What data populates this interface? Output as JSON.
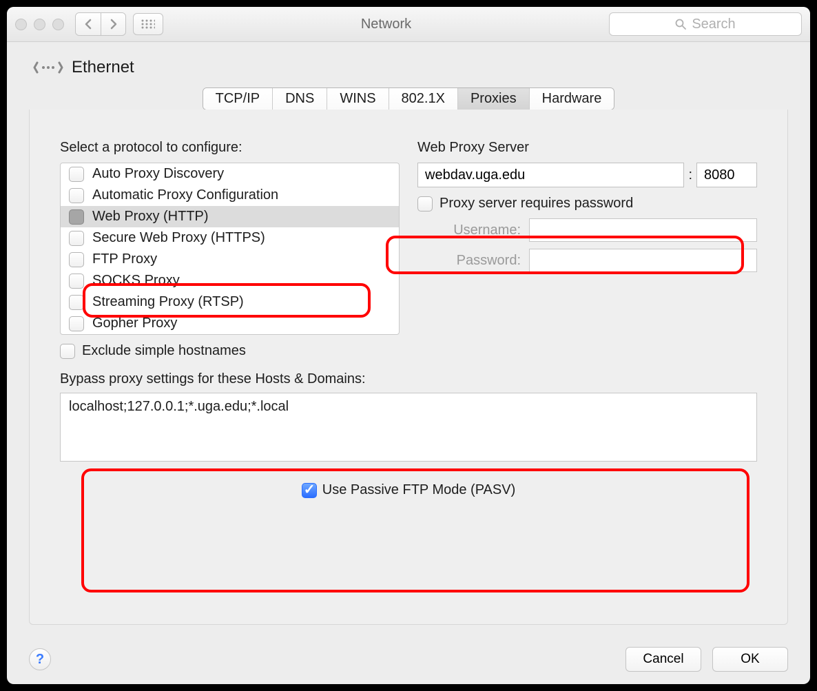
{
  "titlebar": {
    "title": "Network",
    "search_placeholder": "Search"
  },
  "interface": {
    "name": "Ethernet"
  },
  "tabs": [
    {
      "label": "TCP/IP",
      "active": false
    },
    {
      "label": "DNS",
      "active": false
    },
    {
      "label": "WINS",
      "active": false
    },
    {
      "label": "802.1X",
      "active": false
    },
    {
      "label": "Proxies",
      "active": true
    },
    {
      "label": "Hardware",
      "active": false
    }
  ],
  "left": {
    "heading": "Select a protocol to configure:",
    "protocols": [
      {
        "label": "Auto Proxy Discovery",
        "selected": false
      },
      {
        "label": "Automatic Proxy Configuration",
        "selected": false
      },
      {
        "label": "Web Proxy (HTTP)",
        "selected": true
      },
      {
        "label": "Secure Web Proxy (HTTPS)",
        "selected": false
      },
      {
        "label": "FTP Proxy",
        "selected": false
      },
      {
        "label": "SOCKS Proxy",
        "selected": false
      },
      {
        "label": "Streaming Proxy (RTSP)",
        "selected": false
      },
      {
        "label": "Gopher Proxy",
        "selected": false
      }
    ]
  },
  "right": {
    "heading": "Web Proxy Server",
    "host": "webdav.uga.edu",
    "port": "8080",
    "requires_password_label": "Proxy server requires password",
    "username_label": "Username:",
    "password_label": "Password:"
  },
  "exclude_label": "Exclude simple hostnames",
  "bypass": {
    "label": "Bypass proxy settings for these Hosts & Domains:",
    "value": "localhost;127.0.0.1;*.uga.edu;*.local"
  },
  "pasv_label": "Use Passive FTP Mode (PASV)",
  "buttons": {
    "cancel": "Cancel",
    "ok": "OK"
  }
}
